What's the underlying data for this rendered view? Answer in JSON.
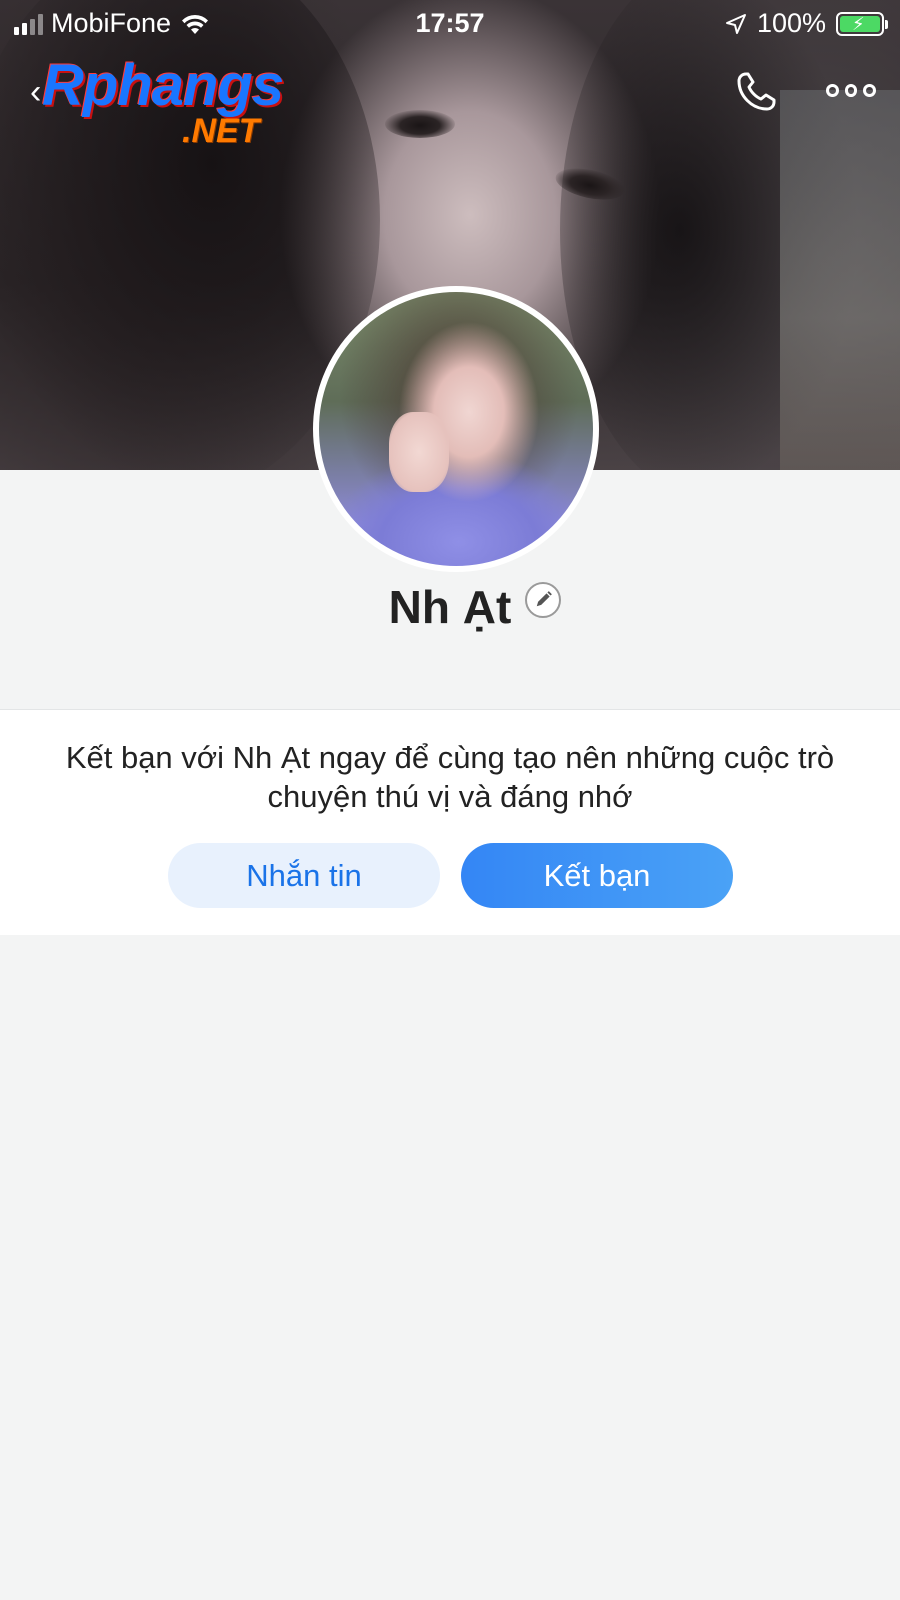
{
  "status_bar": {
    "carrier": "MobiFone",
    "time": "17:57",
    "battery": "100%"
  },
  "watermark": {
    "top": "Rphangs",
    "bottom": ".NET"
  },
  "profile": {
    "name": "Nh Ạt"
  },
  "friend_prompt": {
    "message": "Kết bạn với Nh Ạt ngay để cùng tạo nên những cuộc trò chuyện thú vị và đáng nhớ",
    "message_button": "Nhắn tin",
    "add_friend_button": "Kết bạn"
  },
  "colors": {
    "accent": "#1a73e8",
    "button_light": "#e8f1fd",
    "page_bg": "#f3f4f4"
  },
  "icons": [
    "back-chevron-icon",
    "phone-icon",
    "more-icon",
    "edit-pencil-icon",
    "wifi-icon",
    "location-arrow-icon",
    "battery-icon",
    "signal-icon"
  ]
}
